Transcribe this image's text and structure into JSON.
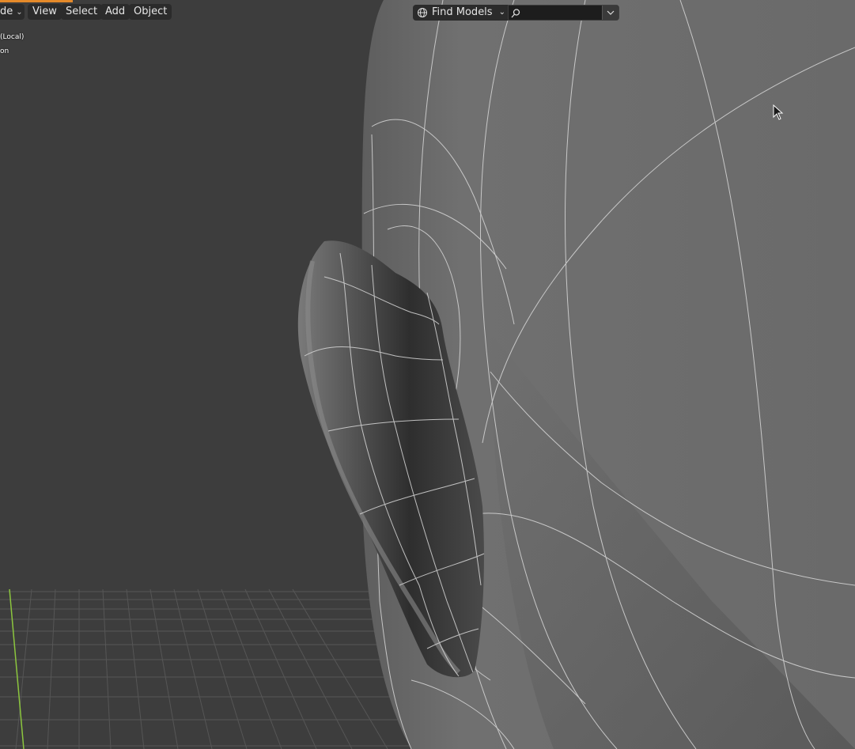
{
  "header": {
    "mode_label": "de",
    "menu": {
      "view": "View",
      "select": "Select",
      "add": "Add",
      "object": "Object"
    }
  },
  "viewport_overlay": {
    "line1": "(Local)",
    "line2": "on"
  },
  "asset_search": {
    "find_label": "Find Models",
    "search_value": "",
    "search_placeholder": ""
  },
  "colors": {
    "background": "#3d3d3d",
    "head_surface": "#6c6c6c",
    "wireframe": "#dcdcdc",
    "grid": "#5a5a5a",
    "accent_tab": "#e58a2a",
    "y_axis": "#8cc63e"
  },
  "icons": {
    "globe": "globe-icon",
    "search": "search-icon",
    "cursor": "mouse-cursor-icon"
  }
}
